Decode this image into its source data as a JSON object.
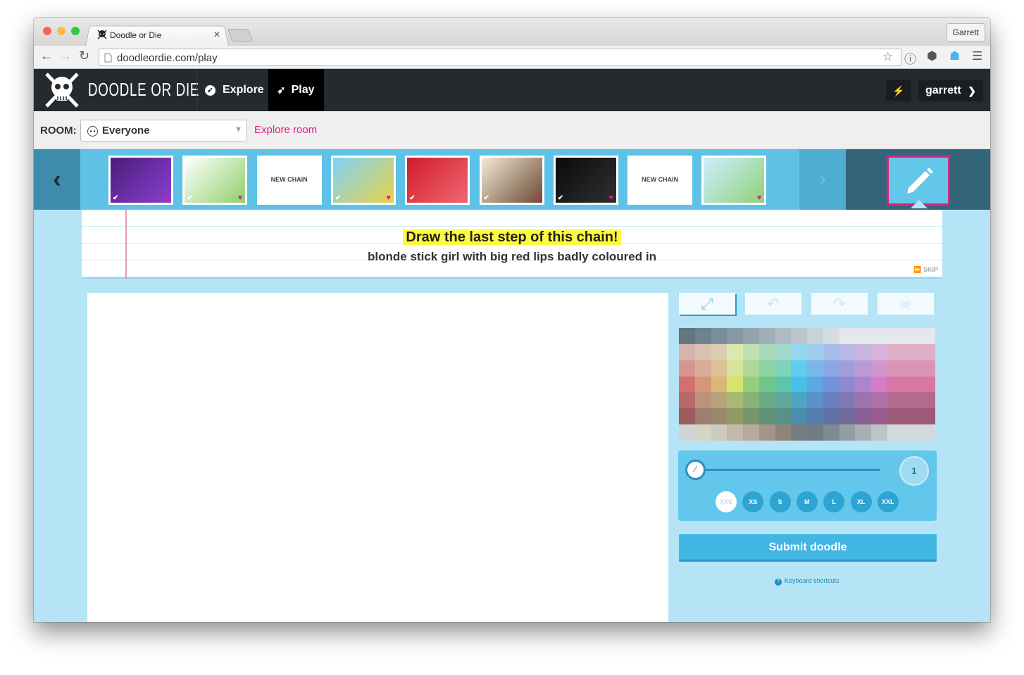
{
  "browser": {
    "tab_title": "Doodle or Die",
    "tab_close": "✕",
    "profile": "Garrett",
    "url": "doodleordie.com/play"
  },
  "nav": {
    "brand": "DOODLE OR DIE",
    "explore": "Explore",
    "play": "Play",
    "user": "garrett"
  },
  "room": {
    "label": "ROOM:",
    "value": "Everyone",
    "explore_link": "Explore room"
  },
  "chain_strip": {
    "thumbs": [
      {
        "type": "doodle",
        "colors": [
          "#4b1d7a",
          "#8a3fd0"
        ],
        "checked": true,
        "loved": true
      },
      {
        "type": "doodle",
        "colors": [
          "#ffffff",
          "#8fd06a"
        ],
        "checked": true,
        "loved": true
      },
      {
        "type": "new",
        "label": "NEW CHAIN"
      },
      {
        "type": "doodle",
        "colors": [
          "#7ed3f7",
          "#e8d24a"
        ],
        "checked": true,
        "loved": true
      },
      {
        "type": "doodle",
        "colors": [
          "#d11b2a",
          "#f06672"
        ],
        "checked": true,
        "loved": false
      },
      {
        "type": "doodle",
        "colors": [
          "#f3ead5",
          "#6b4a35"
        ],
        "checked": true,
        "loved": true
      },
      {
        "type": "doodle",
        "colors": [
          "#0a0a0a",
          "#303030"
        ],
        "checked": true,
        "loved": true
      },
      {
        "type": "new",
        "label": "NEW CHAIN"
      },
      {
        "type": "doodle",
        "colors": [
          "#cfeeff",
          "#8ed27a"
        ],
        "checked": false,
        "loved": true
      }
    ]
  },
  "prompt": {
    "heading": "Draw the last step of this chain!",
    "text": "blonde stick girl with big red lips badly coloured in",
    "skip": "SKIP"
  },
  "tools": [
    "expand-icon",
    "undo-icon",
    "redo-icon",
    "skull-icon"
  ],
  "palette": [
    [
      "#627782",
      "#6e838e",
      "#7a8e98",
      "#8799a3",
      "#94a4ad",
      "#a1b0b8",
      "#aebbc2",
      "#bbc6cc",
      "#c8d2d7",
      "#d5dde1",
      "#e2e8eb"
    ],
    [
      "#d7b3ad",
      "#d9c3b0",
      "#dccfb1",
      "#dae8b2",
      "#bfe0b3",
      "#a9dbb9",
      "#9fdccc",
      "#93d8f0",
      "#9fcbef",
      "#a9bdeb",
      "#b8b7e5",
      "#c9b5e0",
      "#d8b3d8",
      "#e0b0c8"
    ],
    [
      "#d6968f",
      "#d9ac97",
      "#dcc196",
      "#d7e49a",
      "#acd89a",
      "#8ed3a5",
      "#7fd3bd",
      "#62ccec",
      "#79b8ea",
      "#8da7e4",
      "#a39edb",
      "#bb9ad4",
      "#cf97cc",
      "#d995b3"
    ],
    [
      "#d2716c",
      "#d69778",
      "#dab774",
      "#d6e36d",
      "#94cf7b",
      "#6dc78c",
      "#5dc6aa",
      "#46c0e8",
      "#5ca8e5",
      "#7193dc",
      "#8f89d2",
      "#b083cc",
      "#d57cc6",
      "#d877a3"
    ],
    [
      "#b9696a",
      "#b99479",
      "#b4a478",
      "#a9b873",
      "#88b27a",
      "#6aab85",
      "#5ea89a",
      "#4ea4c4",
      "#5a91c6",
      "#6b80be",
      "#8279b4",
      "#9d73ae",
      "#b06fa8",
      "#b46a8c"
    ],
    [
      "#9d5b61",
      "#9c7f6e",
      "#98896b",
      "#8f9a66",
      "#779670",
      "#5f9378",
      "#58908a",
      "#4a8eab",
      "#557dad",
      "#6270a6",
      "#726a9d",
      "#885f95",
      "#995b90",
      "#9c5a77"
    ],
    [
      "#cfd6d4",
      "#d5d4c5",
      "#cdcac2",
      "#c4b9aa",
      "#b8a99a",
      "#a39689",
      "#8e8578",
      "#7a7d80",
      "#707c84",
      "#7d8b92",
      "#919ea4",
      "#a7b1b5",
      "#bcc4c7",
      "#d3d8da"
    ]
  ],
  "brush": {
    "value": "1",
    "sizes": [
      "XXS",
      "XS",
      "S",
      "M",
      "L",
      "XL",
      "XXL"
    ],
    "selected": "XXS"
  },
  "submit_label": "Submit doodle",
  "keyboard_shortcuts": "Keyboard shortcuts",
  "colors": {
    "accent": "#e0207a",
    "header": "#252a2e",
    "strip": "#5ec2e6",
    "panel": "#b4e4f5",
    "button": "#41b5e3"
  }
}
